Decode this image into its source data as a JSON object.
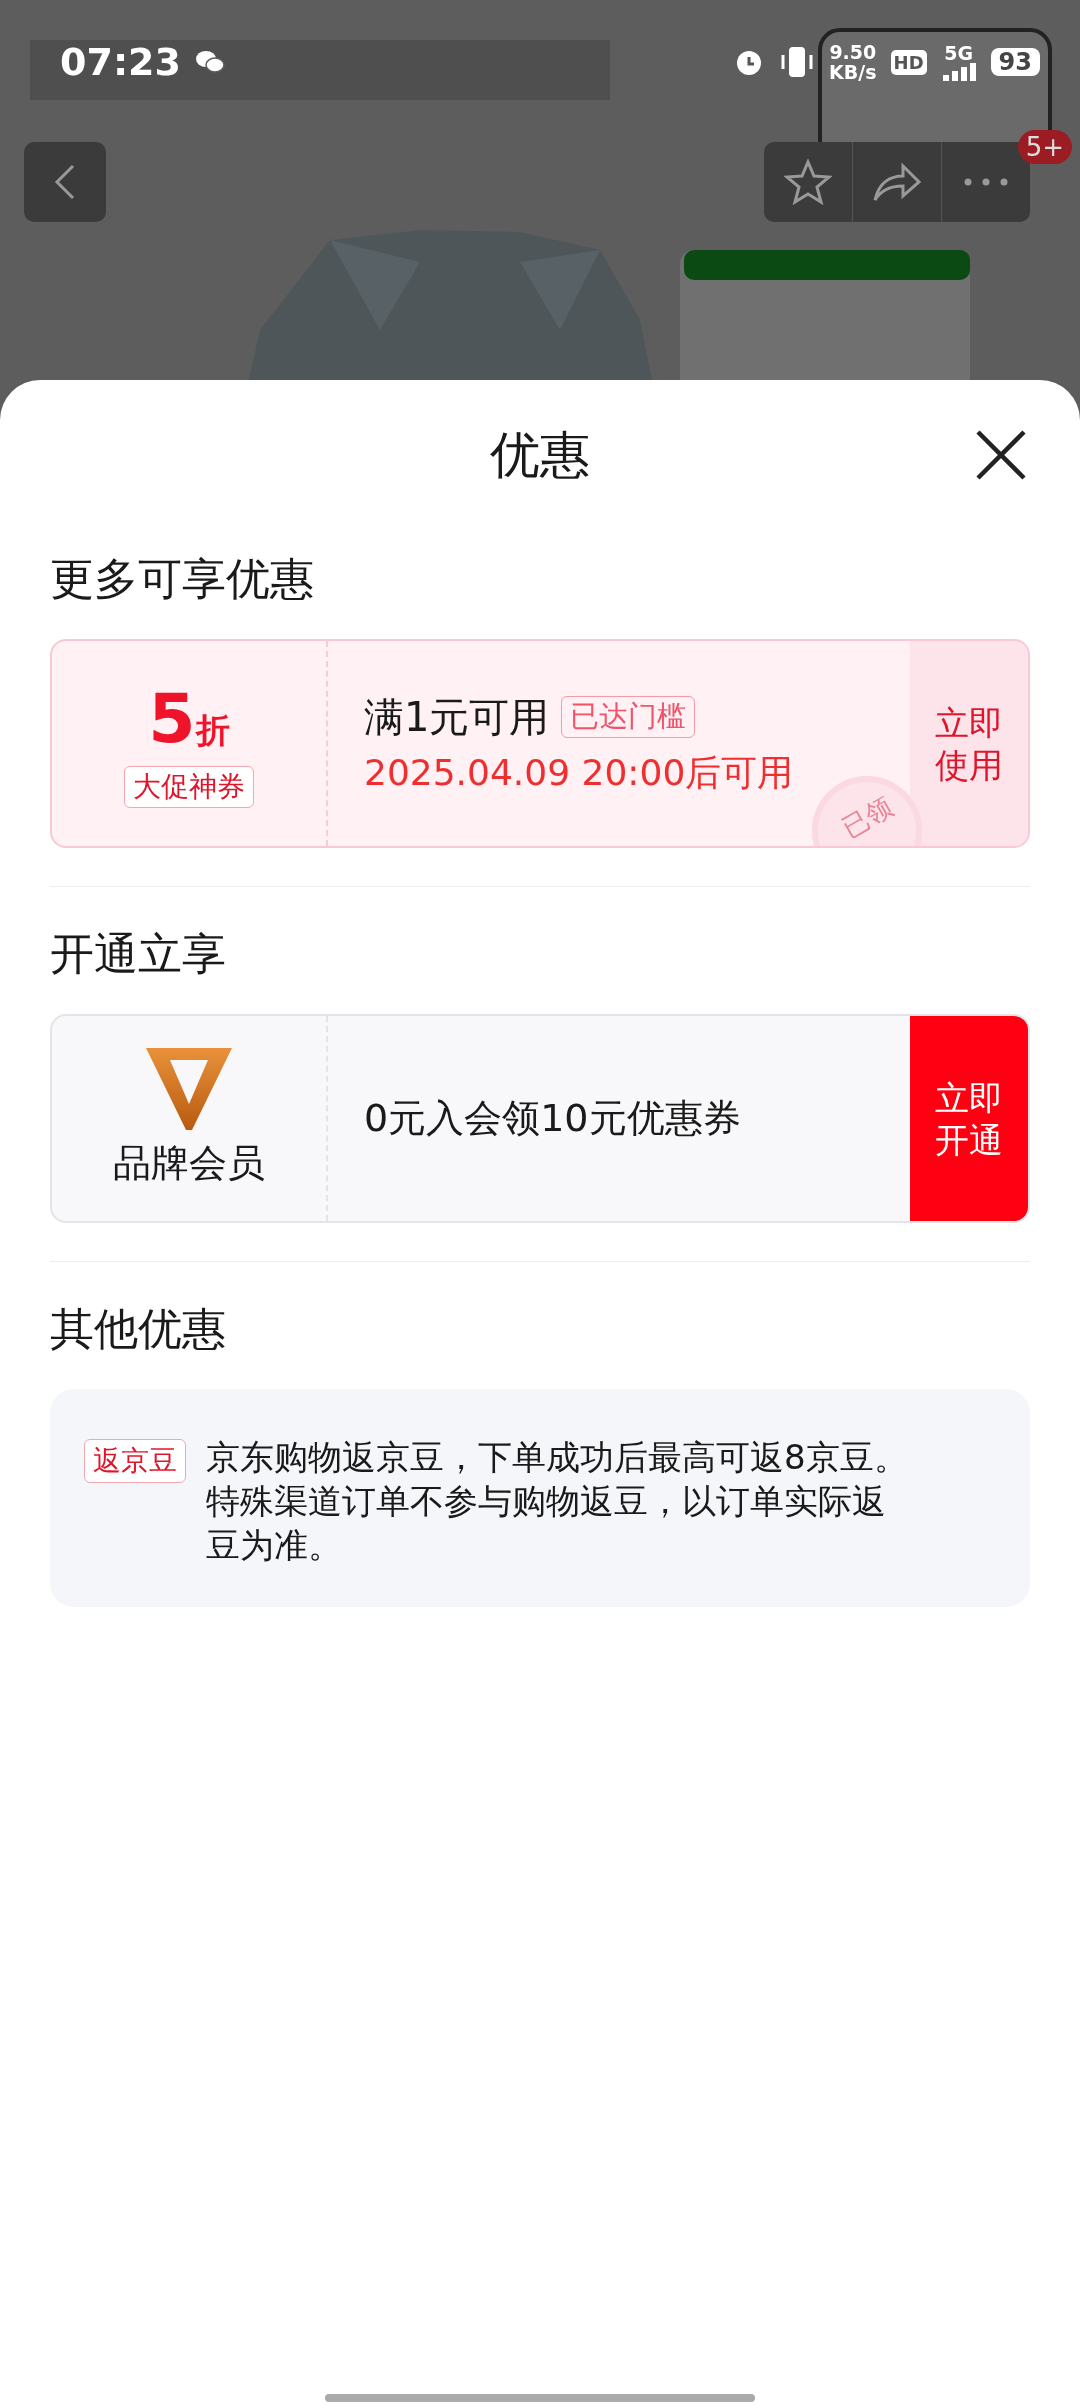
{
  "status_bar": {
    "time": "07:23",
    "speed_value": "9.50",
    "speed_unit": "KB/s",
    "hd": "HD",
    "network": "5G",
    "battery": "93"
  },
  "nav": {
    "badge": "5+"
  },
  "sheet": {
    "title": "优惠",
    "sections": [
      {
        "kind": "coupon",
        "heading": "更多可享优惠",
        "discount_value": "5",
        "discount_unit": "折",
        "tag": "大促神券",
        "condition": "满1元可用",
        "condition_badge": "已达门槛",
        "valid_from": "2025.04.09 20:00后可用",
        "stamp": "已领",
        "action": [
          "立即",
          "使用"
        ]
      },
      {
        "kind": "member",
        "heading": "开通立享",
        "label": "品牌会员",
        "offer": "0元入会领10元优惠券",
        "action": [
          "立即",
          "开通"
        ]
      },
      {
        "kind": "note",
        "heading": "其他优惠",
        "tag": "返京豆",
        "text": "京东购物返京豆，下单成功后最高可返8京豆。特殊渠道订单不参与购物返豆，以订单实际返豆为准。"
      }
    ]
  }
}
